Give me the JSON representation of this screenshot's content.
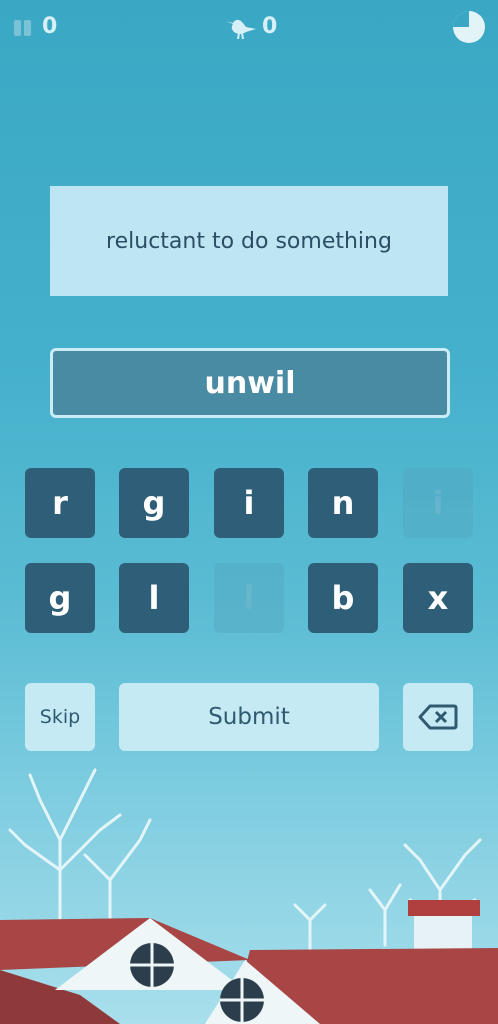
{
  "topbar": {
    "pause_icon": "pause-icon",
    "hints_count": "0",
    "bird_icon": "bird-icon",
    "birds_count": "0",
    "timer_icon": "timer-pie-icon",
    "timer_progress": 0.75
  },
  "clue": "reluctant to do something",
  "answer": "unwil",
  "letters_row1": [
    {
      "letter": "r",
      "used": false
    },
    {
      "letter": "g",
      "used": false
    },
    {
      "letter": "i",
      "used": false
    },
    {
      "letter": "n",
      "used": false
    },
    {
      "letter": "i",
      "used": true
    }
  ],
  "letters_row2": [
    {
      "letter": "g",
      "used": false
    },
    {
      "letter": "l",
      "used": false
    },
    {
      "letter": "l",
      "used": true
    },
    {
      "letter": "b",
      "used": false
    },
    {
      "letter": "x",
      "used": false
    }
  ],
  "buttons": {
    "skip": "Skip",
    "submit": "Submit",
    "backspace_icon": "backspace-icon"
  },
  "colors": {
    "tile": "#2f5f78",
    "button": "#c6eaf4",
    "answer_bg": "#4a8ba4",
    "clue_bg": "#bde6f2"
  }
}
